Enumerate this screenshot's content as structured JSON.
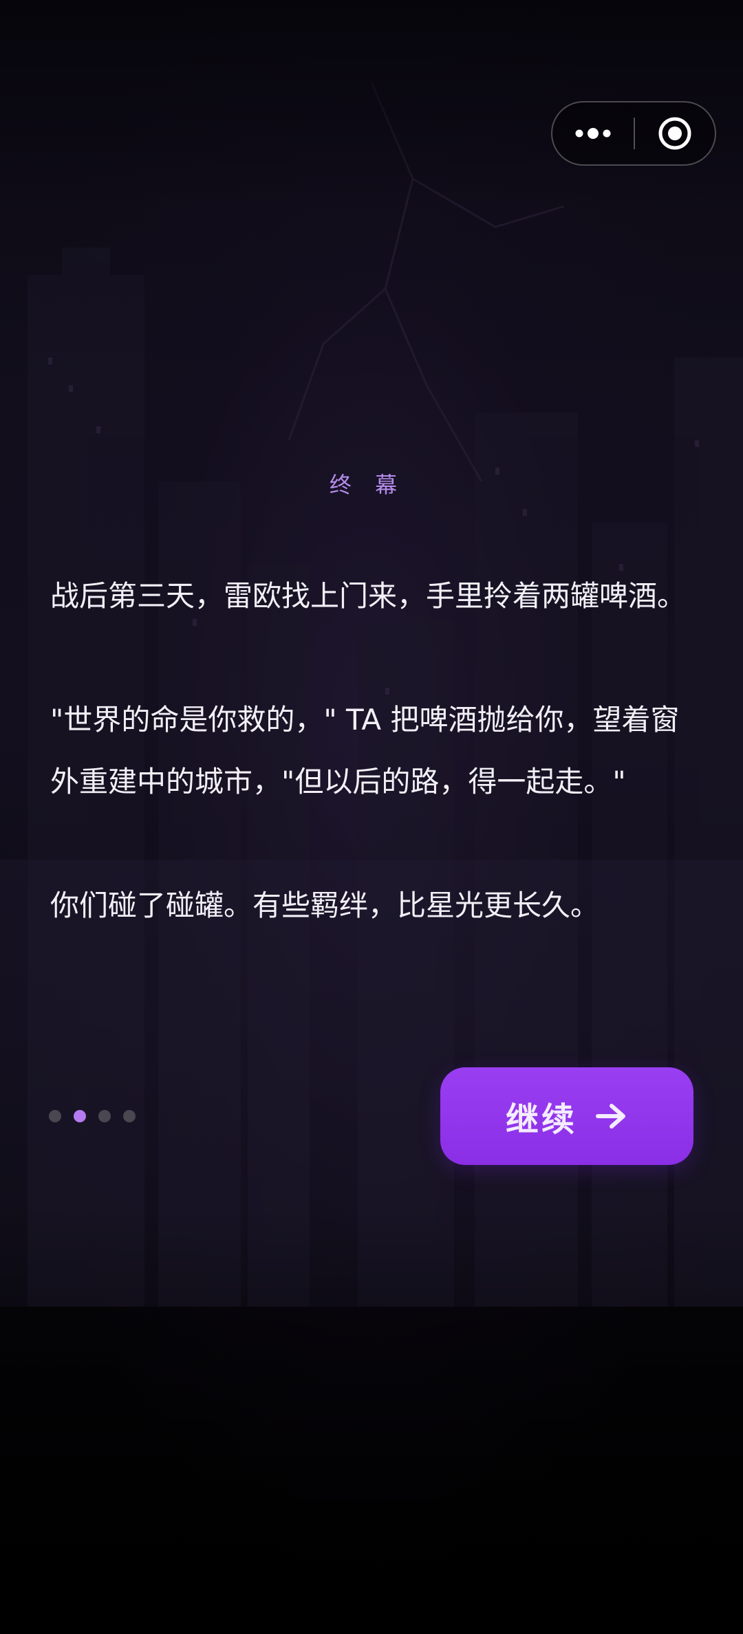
{
  "capsule": {
    "more_icon": "more-dots-icon",
    "close_icon": "target-circle-icon"
  },
  "chapter": {
    "title": "终 幕"
  },
  "story": {
    "paragraphs": [
      "战后第三天，雷欧找上门来，手里拎着两罐啤酒。",
      "\"世界的命是你救的，\" TA 把啤酒抛给你，望着窗外重建中的城市，\"但以后的路，得一起走。\"",
      "你们碰了碰罐。有些羁绊，比星光更长久。"
    ]
  },
  "pagination": {
    "total": 4,
    "current": 2
  },
  "continue_button": {
    "label": "继续",
    "icon": "arrow-right-icon",
    "color": "#8f36ec"
  },
  "colors": {
    "accent": "#b58cec",
    "dot_active": "#b47cf0",
    "dot_inactive": "#4a4750"
  }
}
